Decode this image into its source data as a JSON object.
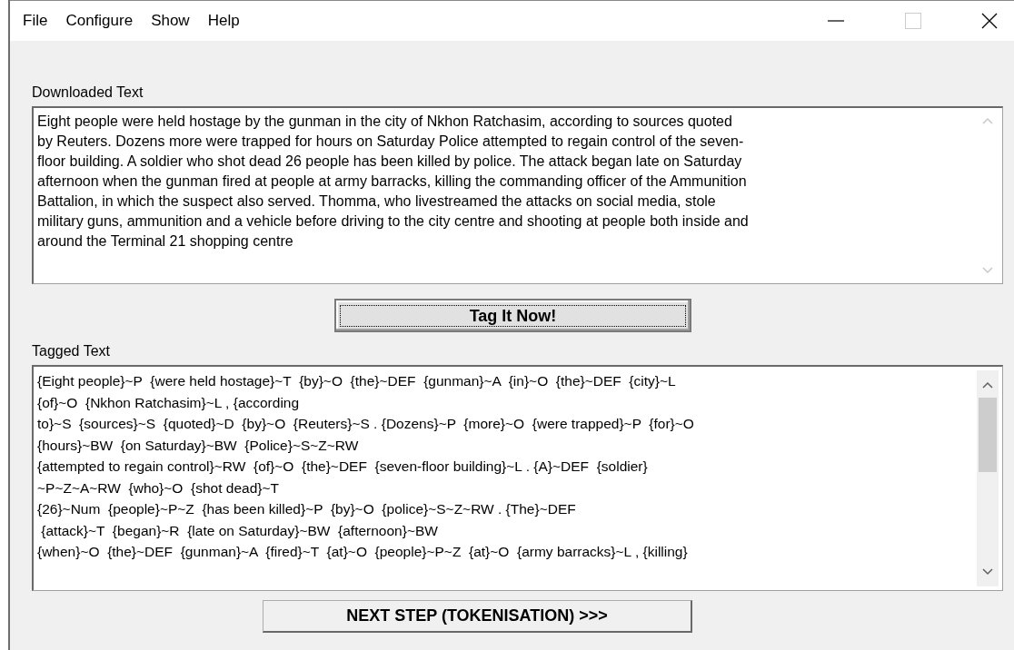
{
  "menu": [
    "File",
    "Configure",
    "Show",
    "Help"
  ],
  "downloaded": {
    "label": "Downloaded Text",
    "lines": [
      "Eight people were held hostage by the gunman in the city of Nkhon Ratchasim, according to sources quoted",
      "by Reuters. Dozens more were trapped for hours on Saturday Police attempted to regain control of the seven-",
      "floor building. A soldier who shot dead 26 people has been killed by police. The attack began late on Saturday",
      "afternoon when the gunman fired at people at army barracks, killing the commanding officer of the Ammunition",
      "Battalion, in which the suspect also served. Thomma, who livestreamed the attacks on social media, stole",
      "military guns, ammunition and a vehicle before driving to the city centre and shooting at people both inside and",
      "around the Terminal 21 shopping centre"
    ]
  },
  "tag_button": "Tag It Now!",
  "tagged": {
    "label": "Tagged Text",
    "lines": [
      "{Eight people}~P  {were held hostage}~T  {by}~O  {the}~DEF  {gunman}~A  {in}~O  {the}~DEF  {city}~L",
      "{of}~O  {Nkhon Ratchasim}~L , {according",
      "to}~S  {sources}~S  {quoted}~D  {by}~O  {Reuters}~S . {Dozens}~P  {more}~O  {were trapped}~P  {for}~O",
      "{hours}~BW  {on Saturday}~BW  {Police}~S~Z~RW",
      "{attempted to regain control}~RW  {of}~O  {the}~DEF  {seven-floor building}~L . {A}~DEF  {soldier}",
      "~P~Z~A~RW  {who}~O  {shot dead}~T",
      "{26}~Num  {people}~P~Z  {has been killed}~P  {by}~O  {police}~S~Z~RW . {The}~DEF",
      " {attack}~T  {began}~R  {late on Saturday}~BW  {afternoon}~BW",
      "{when}~O  {the}~DEF  {gunman}~A  {fired}~T  {at}~O  {people}~P~Z  {at}~O  {army barracks}~L , {killing}"
    ]
  },
  "next_button": "NEXT STEP (TOKENISATION) >>>"
}
